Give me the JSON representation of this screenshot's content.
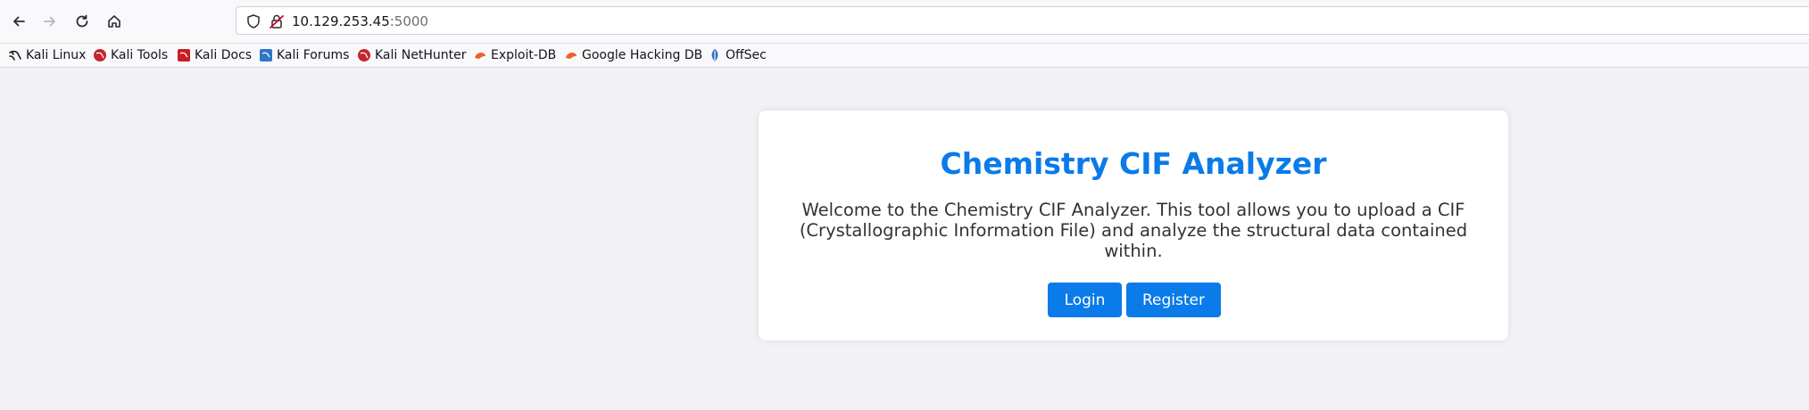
{
  "browser": {
    "url_host": "10.129.253.45",
    "url_port": ":5000",
    "bookmarks": [
      {
        "label": "Kali Linux",
        "icon": "kali-dragon-icon"
      },
      {
        "label": "Kali Tools",
        "icon": "kali-tools-icon"
      },
      {
        "label": "Kali Docs",
        "icon": "kali-docs-icon"
      },
      {
        "label": "Kali Forums",
        "icon": "kali-forums-icon"
      },
      {
        "label": "Kali NetHunter",
        "icon": "kali-nethunter-icon"
      },
      {
        "label": "Exploit-DB",
        "icon": "exploit-db-icon"
      },
      {
        "label": "Google Hacking DB",
        "icon": "ghdb-icon"
      },
      {
        "label": "OffSec",
        "icon": "offsec-icon"
      }
    ]
  },
  "page": {
    "title": "Chemistry CIF Analyzer",
    "description": "Welcome to the Chemistry CIF Analyzer. This tool allows you to upload a CIF (Crystallographic Information File) and analyze the structural data contained within.",
    "login_label": "Login",
    "register_label": "Register",
    "accent_color": "#0a7be8"
  }
}
